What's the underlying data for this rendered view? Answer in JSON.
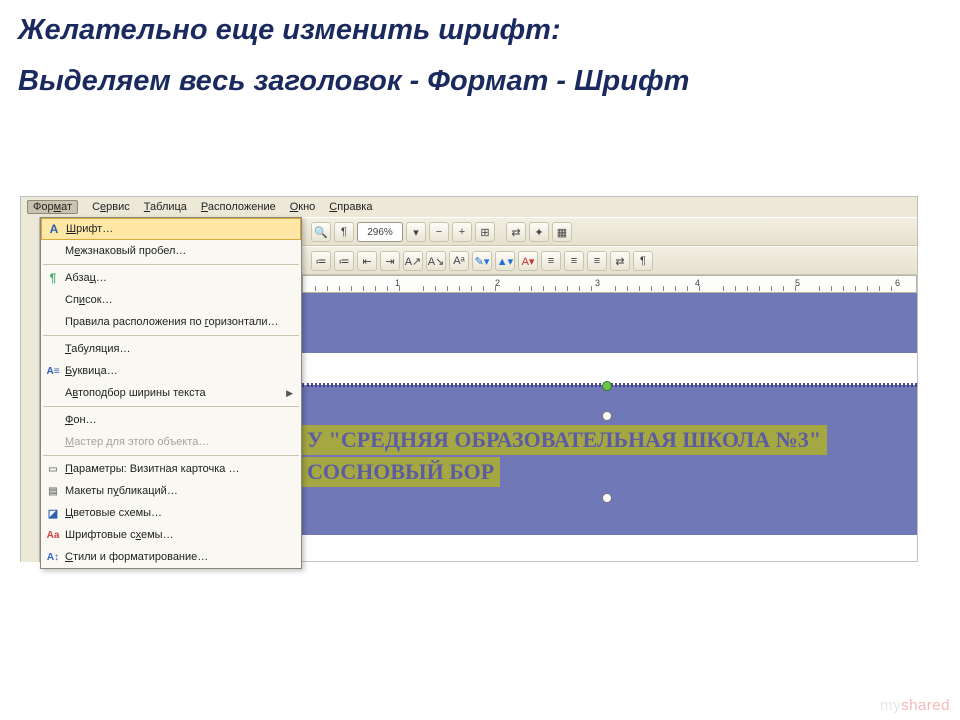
{
  "slide": {
    "heading1": "Желательно еще изменить шрифт:",
    "heading2": "Выделяем весь заголовок - Формат - Шрифт"
  },
  "menubar": {
    "items": [
      {
        "label_pre": "Фор",
        "label_ul": "м",
        "label_post": "ат",
        "active": true
      },
      {
        "label_pre": "С",
        "label_ul": "е",
        "label_post": "рвис",
        "active": false
      },
      {
        "label_pre": "",
        "label_ul": "Т",
        "label_post": "аблица",
        "active": false
      },
      {
        "label_pre": "",
        "label_ul": "Р",
        "label_post": "асположение",
        "active": false
      },
      {
        "label_pre": "",
        "label_ul": "О",
        "label_post": "кно",
        "active": false
      },
      {
        "label_pre": "",
        "label_ul": "С",
        "label_post": "правка",
        "active": false
      }
    ]
  },
  "dropdown": {
    "items": [
      {
        "icon": "A",
        "label_pre": "",
        "label_ul": "Ш",
        "label_post": "рифт…",
        "highlighted": true
      },
      {
        "icon": "",
        "label_pre": "М",
        "label_ul": "е",
        "label_post": "жзнаковый пробел…"
      },
      {
        "sep": true
      },
      {
        "icon": "",
        "label_pre": "Абза",
        "label_ul": "ц",
        "label_post": "…",
        "iconGlyph": "¶"
      },
      {
        "icon": "",
        "label_pre": "Сп",
        "label_ul": "и",
        "label_post": "сок…"
      },
      {
        "icon": "",
        "label_pre": "Правила расположения по ",
        "label_ul": "г",
        "label_post": "оризонтали…"
      },
      {
        "sep": true
      },
      {
        "icon": "",
        "label_pre": "",
        "label_ul": "Т",
        "label_post": "абуляция…"
      },
      {
        "icon": "A≡",
        "label_pre": "",
        "label_ul": "Б",
        "label_post": "уквица…"
      },
      {
        "icon": "",
        "label_pre": "А",
        "label_ul": "в",
        "label_post": "топодбор ширины текста",
        "arrow": true
      },
      {
        "sep": true
      },
      {
        "icon": "",
        "label_pre": "",
        "label_ul": "Ф",
        "label_post": "он…"
      },
      {
        "icon": "",
        "label_pre": "",
        "label_ul": "М",
        "label_post": "астер для этого объекта…",
        "disabled": true
      },
      {
        "sep": true
      },
      {
        "icon": "",
        "label_pre": "",
        "label_ul": "П",
        "label_post": "араметры: Визитная карточка …"
      },
      {
        "icon": "",
        "label_pre": "Макеты п",
        "label_ul": "у",
        "label_post": "бликаций…"
      },
      {
        "icon": "◪",
        "label_pre": "",
        "label_ul": "Ц",
        "label_post": "ветовые схемы…"
      },
      {
        "icon": "Aа",
        "label_pre": "Шрифтовые с",
        "label_ul": "х",
        "label_post": "емы…"
      },
      {
        "icon": "A↕",
        "label_pre": "",
        "label_ul": "С",
        "label_post": "тили и форматирование…"
      }
    ]
  },
  "toolbar": {
    "zoom_value": "296%",
    "icons_row1": [
      "🔍",
      "¶",
      "296%",
      "↕",
      "🔍−",
      "🔍+",
      "⊞",
      "",
      "⇄",
      "✦",
      "⊞"
    ],
    "icons_row2": [
      "≔",
      "≔",
      "⋮⋮",
      "⊟",
      "⊟",
      "A↑",
      "A↑",
      "Aᵃ",
      "✎",
      "▲",
      "A",
      "≡",
      "≡",
      "≡",
      "⇄",
      "⏎",
      "¶"
    ]
  },
  "ruler": {
    "numbers": [
      "1",
      "2",
      "3",
      "4",
      "5",
      "6"
    ]
  },
  "document": {
    "selected_text_line1": "У \"СРЕДНЯЯ ОБРАЗОВАТЕЛЬНАЯ ШКОЛА №3\"",
    "selected_text_line2": "СОСНОВЫЙ БОР"
  },
  "watermark": {
    "pre": "my",
    "red": "shared",
    "post": ""
  }
}
